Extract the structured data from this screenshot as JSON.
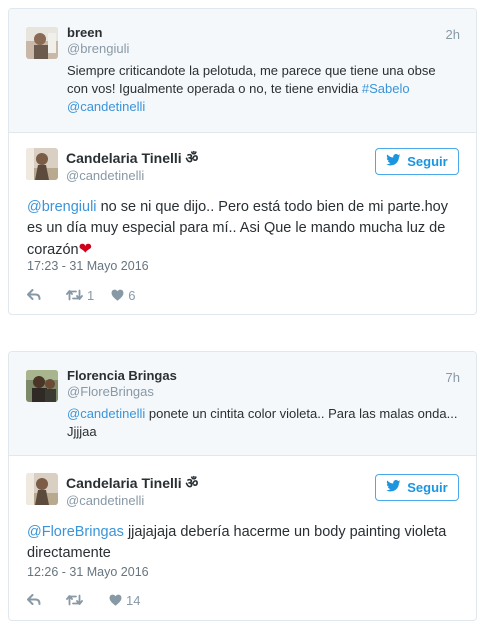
{
  "tweets": [
    {
      "quoted": {
        "name": "breen",
        "handle": "@brengiuli",
        "time": "2h",
        "text_line1": "Siempre criticandote la pelotuda, me parece que tiene una obse con",
        "text_line2_pre": "vos! Igualmente operada o no, te tiene envidia ",
        "text_hashtag": "#Sabelo",
        "text_mention": "@candetinelli"
      },
      "main": {
        "name": "Candelaria Tinelli ॐ",
        "handle": "@candetinelli",
        "follow_label": "Seguir",
        "text_mention": "@brengiuli",
        "text_rest": " no se ni que dijo.. Pero está todo bien de mi parte.hoy es un día muy especial para mí.. Asi Que le mando mucha luz de corazón",
        "text_emoji": "❤",
        "date": "17:23 - 31 Mayo 2016",
        "retweets": "1",
        "likes": "6"
      }
    },
    {
      "quoted": {
        "name": "Florencia Bringas",
        "handle": "@FloreBringas",
        "time": "7h",
        "text_mention": "@candetinelli",
        "text_rest": " ponete un cintita color violeta.. Para las malas onda...",
        "text_line2": "Jjjjaa"
      },
      "main": {
        "name": "Candelaria Tinelli ॐ",
        "handle": "@candetinelli",
        "follow_label": "Seguir",
        "text_mention": "@FloreBringas",
        "text_rest": " jjajajaja debería hacerme un body painting violeta directamente",
        "date": "12:26 - 31 Mayo 2016",
        "retweets": "",
        "likes": "14"
      }
    }
  ],
  "colors": {
    "link": "#3b94d9",
    "follow_border": "#4aa8eb",
    "muted": "#8899a6",
    "heart": "#d0021b"
  },
  "icons": [
    "twitter-bird-icon",
    "reply-icon",
    "retweet-icon",
    "heart-icon"
  ]
}
